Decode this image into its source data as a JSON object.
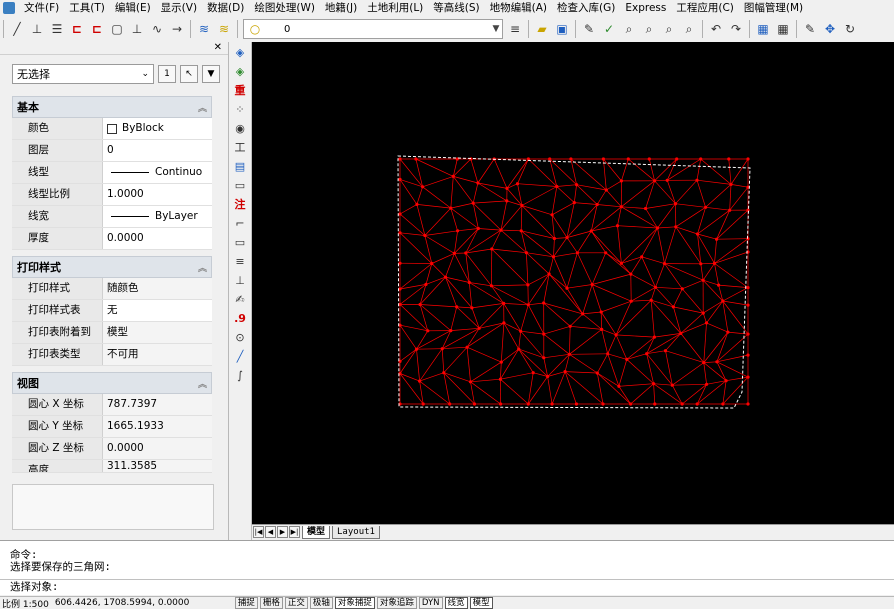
{
  "menu": [
    "文件(F)",
    "工具(T)",
    "编辑(E)",
    "显示(V)",
    "数据(D)",
    "绘图处理(W)",
    "地籍(J)",
    "土地利用(L)",
    "等高线(S)",
    "地物编辑(A)",
    "检查入库(G)",
    "Express",
    "工程应用(C)",
    "图幅管理(M)"
  ],
  "toolbar": {
    "layer_value": "0"
  },
  "panel": {
    "selection": "无选择",
    "sections": [
      {
        "title": "基本",
        "rows": [
          {
            "name": "颜色",
            "value": "ByBlock"
          },
          {
            "name": "图层",
            "value": "0"
          },
          {
            "name": "线型",
            "value": "Continuo"
          },
          {
            "name": "线型比例",
            "value": "1.0000"
          },
          {
            "name": "线宽",
            "value": "ByLayer"
          },
          {
            "name": "厚度",
            "value": "0.0000"
          }
        ]
      },
      {
        "title": "打印样式",
        "rows": [
          {
            "name": "打印样式",
            "value": "随颜色"
          },
          {
            "name": "打印样式表",
            "value": "无"
          },
          {
            "name": "打印表附着到",
            "value": "模型"
          },
          {
            "name": "打印表类型",
            "value": "不可用"
          }
        ]
      },
      {
        "title": "视图",
        "rows": [
          {
            "name": "圆心 X 坐标",
            "value": "787.7397"
          },
          {
            "name": "圆心 Y 坐标",
            "value": "1665.1933"
          },
          {
            "name": "圆心 Z 坐标",
            "value": "0.0000"
          },
          {
            "name": "高度",
            "value": "311.3585"
          }
        ]
      }
    ]
  },
  "vtoolbar_labels": {
    "zhong": "重",
    "zhu": "注",
    "nine": ".9"
  },
  "tabs": {
    "model": "模型",
    "layout1": "Layout1"
  },
  "command": {
    "line1": "命令:",
    "line2": "选择要保存的三角网:",
    "prompt": "选择对象:"
  },
  "status": {
    "scale": "比例 1:500",
    "coords": "606.4426, 1708.5994, 0.0000",
    "toggles": [
      {
        "label": "捕捉",
        "on": false
      },
      {
        "label": "栅格",
        "on": false
      },
      {
        "label": "正交",
        "on": false
      },
      {
        "label": "极轴",
        "on": false
      },
      {
        "label": "对象捕捉",
        "on": true
      },
      {
        "label": "对象追踪",
        "on": false
      },
      {
        "label": "DYN",
        "on": false
      },
      {
        "label": "线宽",
        "on": true
      },
      {
        "label": "模型",
        "on": true
      }
    ]
  },
  "colors": {
    "tin_red": "#ff0000",
    "canvas_bg": "#000000",
    "boundary": "#ffffff"
  }
}
